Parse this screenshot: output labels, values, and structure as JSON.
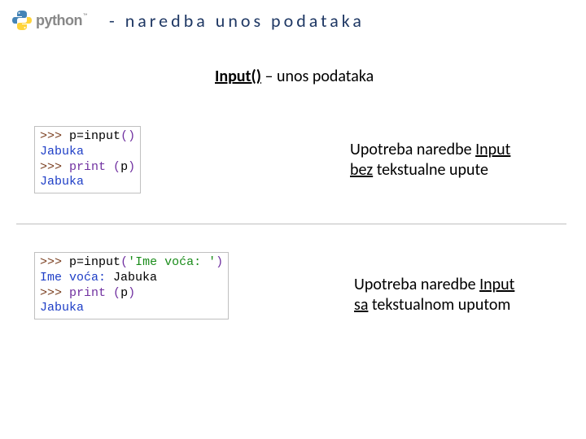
{
  "header": {
    "logo_text": "python",
    "tm": "™",
    "title": "- naredba unos podataka"
  },
  "subtitle": {
    "function": "Input()",
    "rest": " – unos podataka"
  },
  "code1": {
    "l1_prompt": ">>> ",
    "l1_lhs": "p",
    "l1_eq": "=",
    "l1_fn": "input",
    "l1_par": "()",
    "l2": "Jabuka",
    "l3_prompt": ">>> ",
    "l3_fn": "print",
    "l3_sp": " ",
    "l3_paren_o": "(",
    "l3_arg": "p",
    "l3_paren_c": ")",
    "l4": "Jabuka"
  },
  "desc1": {
    "t1": "Upotreba naredbe ",
    "t1b": "Input",
    "t2a": "bez",
    "t2b": " tekstualne upute"
  },
  "code2": {
    "l1_prompt": ">>> ",
    "l1_lhs": "p",
    "l1_eq": "=",
    "l1_fn": "input",
    "l1_par_o": "(",
    "l1_str": "'Ime voća: '",
    "l1_par_c": ")",
    "l2a": "Ime voća: ",
    "l2b": "Jabuka",
    "l3_prompt": ">>> ",
    "l3_fn": "print",
    "l3_sp": " ",
    "l3_paren_o": "(",
    "l3_arg": "p",
    "l3_paren_c": ")",
    "l4": "Jabuka"
  },
  "desc2": {
    "t1": "Upotreba naredbe ",
    "t1b": "Input",
    "t2a": "sa",
    "t2b": " tekstualnom uputom"
  }
}
